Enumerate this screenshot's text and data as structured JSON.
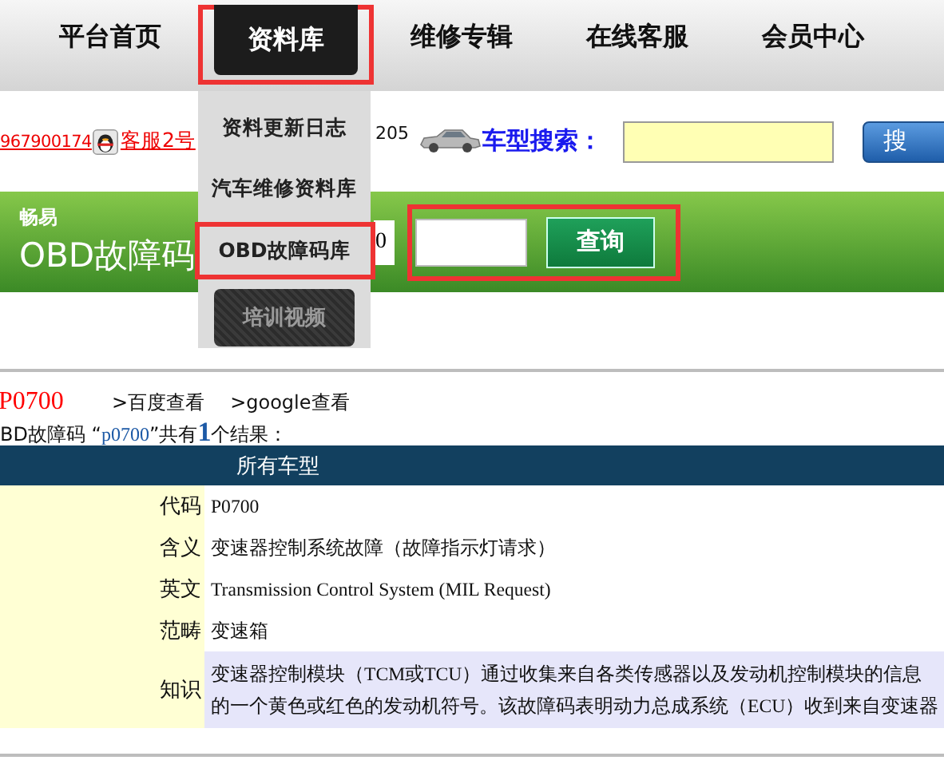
{
  "nav": {
    "items": [
      {
        "label": "平台首页",
        "selected": false,
        "highlighted": false
      },
      {
        "label": "资料库",
        "selected": true,
        "highlighted": true
      },
      {
        "label": "维修专辑",
        "selected": false,
        "highlighted": false
      },
      {
        "label": "在线客服",
        "selected": false,
        "highlighted": false
      },
      {
        "label": "会员中心",
        "selected": false,
        "highlighted": false
      }
    ]
  },
  "dropdown": {
    "items": [
      {
        "label": "资料更新日志",
        "kind": "plain",
        "highlighted": false
      },
      {
        "label": "汽车维修资料库",
        "kind": "plain",
        "highlighted": false
      },
      {
        "label": "OBD故障码库",
        "kind": "plain",
        "highlighted": true
      },
      {
        "label": "培训视频",
        "kind": "dark",
        "highlighted": false
      }
    ]
  },
  "contact": {
    "qq_number": "967900174",
    "service_link": "客服2号",
    "phone_tail": "205"
  },
  "model_search": {
    "label": "车型搜索：",
    "button": "搜"
  },
  "banner": {
    "brand": "畅易",
    "title": "OBD故障码",
    "code_value": "0",
    "button": "查询",
    "highlighted": true
  },
  "result": {
    "code": "P0700",
    "links": [
      ">百度查看",
      ">google查看"
    ],
    "summary_prefix": "BD故障码 “",
    "query": "p0700",
    "summary_middle": "”共有",
    "count": "1",
    "summary_suffix": "个结果："
  },
  "table": {
    "header": "所有车型",
    "rows": [
      {
        "label": "代码",
        "lines": [
          "P0700"
        ],
        "shaded": false
      },
      {
        "label": "含义",
        "lines": [
          "变速器控制系统故障（故障指示灯请求）"
        ],
        "shaded": false
      },
      {
        "label": "英文",
        "lines": [
          "Transmission Control System (MIL Request)"
        ],
        "shaded": false
      },
      {
        "label": "范畴",
        "lines": [
          "变速箱"
        ],
        "shaded": false
      },
      {
        "label": "知识",
        "lines": [
          "变速器控制模块（TCM或TCU）通过收集来自各类传感器以及发动机控制模块的信息",
          "的一个黄色或红色的发动机符号。该故障码表明动力总成系统（ECU）收到来自变速器"
        ],
        "shaded": true
      }
    ]
  }
}
